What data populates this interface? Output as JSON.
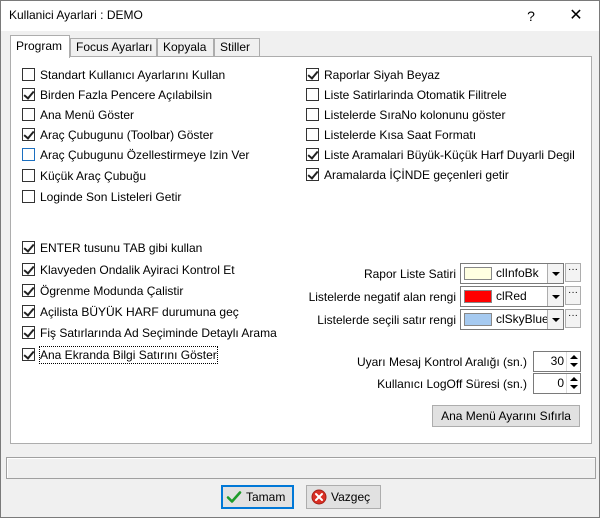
{
  "window": {
    "title": "Kullanici Ayarlari : DEMO",
    "help_label": "?",
    "close_label": "✕"
  },
  "tabs": [
    {
      "label": "Program",
      "active": true
    },
    {
      "label": "Focus Ayarları",
      "active": false
    },
    {
      "label": "Kopyala",
      "active": false
    },
    {
      "label": "Stiller",
      "active": false
    }
  ],
  "left_options": [
    {
      "label": "Standart Kullanıcı Ayarlarını Kullan",
      "checked": false
    },
    {
      "label": "Birden Fazla Pencere Açılabilsin",
      "checked": true
    },
    {
      "label": "Ana Menü Göster",
      "checked": false
    },
    {
      "label": "Araç Çubugunu (Toolbar) Göster",
      "checked": true
    },
    {
      "label": "Araç Çubugunu Özellestirmeye Izin Ver",
      "checked": false
    },
    {
      "label": "Küçük Araç Çubuğu",
      "checked": false
    },
    {
      "label": "Loginde Son Listeleri Getir",
      "checked": false
    }
  ],
  "right_options": [
    {
      "label": "Raporlar Siyah Beyaz",
      "checked": true
    },
    {
      "label": "Liste Satirlarinda Otomatik Filitrele",
      "checked": false
    },
    {
      "label": "Listelerde SıraNo kolonunu göster",
      "checked": false
    },
    {
      "label": "Listelerde Kısa Saat Formatı",
      "checked": false
    },
    {
      "label": "Liste Aramalari Büyük-Küçük Harf Duyarli Degil",
      "checked": true
    },
    {
      "label": "Aramalarda İÇİNDE geçenleri getir",
      "checked": true
    }
  ],
  "lower_options": [
    {
      "label": "ENTER tusunu TAB gibi kullan",
      "checked": true
    },
    {
      "label": "Klavyeden Ondalik Ayiraci Kontrol Et",
      "checked": true
    },
    {
      "label": "Ögrenme Modunda Çalistir",
      "checked": true
    },
    {
      "label": "Açilista BÜYÜK HARF durumuna geç",
      "checked": true
    },
    {
      "label": "Fiş Satırlarında Ad Seçiminde Detaylı Arama",
      "checked": true
    },
    {
      "label": "Ana Ekranda Bilgi Satırını Göster",
      "checked": true
    }
  ],
  "colors": [
    {
      "label": "Rapor Liste Satiri",
      "value": "clInfoBk",
      "swatch": "#ffffe1"
    },
    {
      "label": "Listelerde negatif alan rengi",
      "value": "clRed",
      "swatch": "#ff0000"
    },
    {
      "label": "Listelerde seçili satır rengi",
      "value": "clSkyBlue",
      "swatch": "#a6caf0"
    }
  ],
  "spinners": [
    {
      "label": "Uyarı Mesaj Kontrol Aralığı (sn.)",
      "value": "30"
    },
    {
      "label": "Kullanıcı LogOff Süresi (sn.)",
      "value": "0"
    }
  ],
  "reset_button": "Ana Menü Ayarını Sıfırla",
  "ok_button": "Tamam",
  "cancel_button": "Vazgeç",
  "dots_label": "···",
  "accent_color": "#0078d7"
}
